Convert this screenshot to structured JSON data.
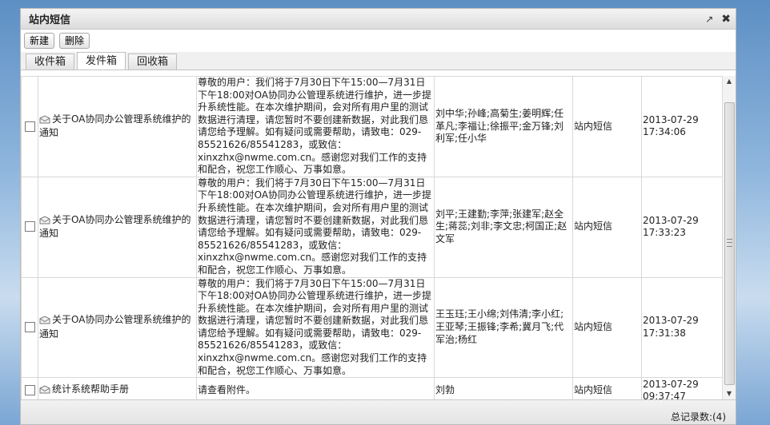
{
  "window": {
    "title": "站内短信"
  },
  "toolbar": {
    "new_label": "新建",
    "delete_label": "删除"
  },
  "tabs": [
    {
      "label": "收件箱",
      "active": false
    },
    {
      "label": "发件箱",
      "active": true
    },
    {
      "label": "回收箱",
      "active": false
    }
  ],
  "messages": [
    {
      "subject": "关于OA协同办公管理系统维护的通知",
      "content": "尊敬的用户：我们将于7月30日下午15:00—7月31日下午18:00对OA协同办公管理系统进行维护，进一步提升系统性能。在本次维护期间，会对所有用户里的测试数据进行清理，请您暂时不要创建新数据，对此我们恳请您给予理解。如有疑问或需要帮助，请致电：029-85521626/85541283，或致信：xinxzhx@nwme.com.cn。感谢您对我们工作的支持和配合，祝您工作顺心、万事如意。",
      "recipients": "刘中华;孙峰;高菊生;姜明辉;任革凡;李福让;徐振平;金万锋;刘利军;任小华",
      "type": "站内短信",
      "date": "2013-07-29",
      "time": "17:34:06"
    },
    {
      "subject": "关于OA协同办公管理系统维护的通知",
      "content": "尊敬的用户：我们将于7月30日下午15:00—7月31日下午18:00对OA协同办公管理系统进行维护，进一步提升系统性能。在本次维护期间，会对所有用户里的测试数据进行清理，请您暂时不要创建新数据，对此我们恳请您给予理解。如有疑问或需要帮助，请致电：029-85521626/85541283，或致信：xinxzhx@nwme.com.cn。感谢您对我们工作的支持和配合，祝您工作顺心、万事如意。",
      "recipients": "刘平;王建勤;李萍;张建军;赵全生;蒋蕊;刘非;李文忠;柯国正;赵文军",
      "type": "站内短信",
      "date": "2013-07-29",
      "time": "17:33:23"
    },
    {
      "subject": "关于OA协同办公管理系统维护的通知",
      "content": "尊敬的用户：我们将于7月30日下午15:00—7月31日下午18:00对OA协同办公管理系统进行维护，进一步提升系统性能。在本次维护期间，会对所有用户里的测试数据进行清理，请您暂时不要创建新数据，对此我们恳请您给予理解。如有疑问或需要帮助，请致电：029-85521626/85541283，或致信：xinxzhx@nwme.com.cn。感谢您对我们工作的支持和配合，祝您工作顺心、万事如意。",
      "recipients": "王玉珏;王小绵;刘伟清;李小红;王亚琴;王振锋;李希;冀月飞;代军治;杨红",
      "type": "站内短信",
      "date": "2013-07-29",
      "time": "17:31:38"
    },
    {
      "subject": "统计系统帮助手册",
      "content": "请查看附件。",
      "recipients": "刘勃",
      "type": "站内短信",
      "date": "2013-07-29",
      "time": "09:37:47"
    }
  ],
  "footer": {
    "total_label": "总记录数:(4)"
  }
}
